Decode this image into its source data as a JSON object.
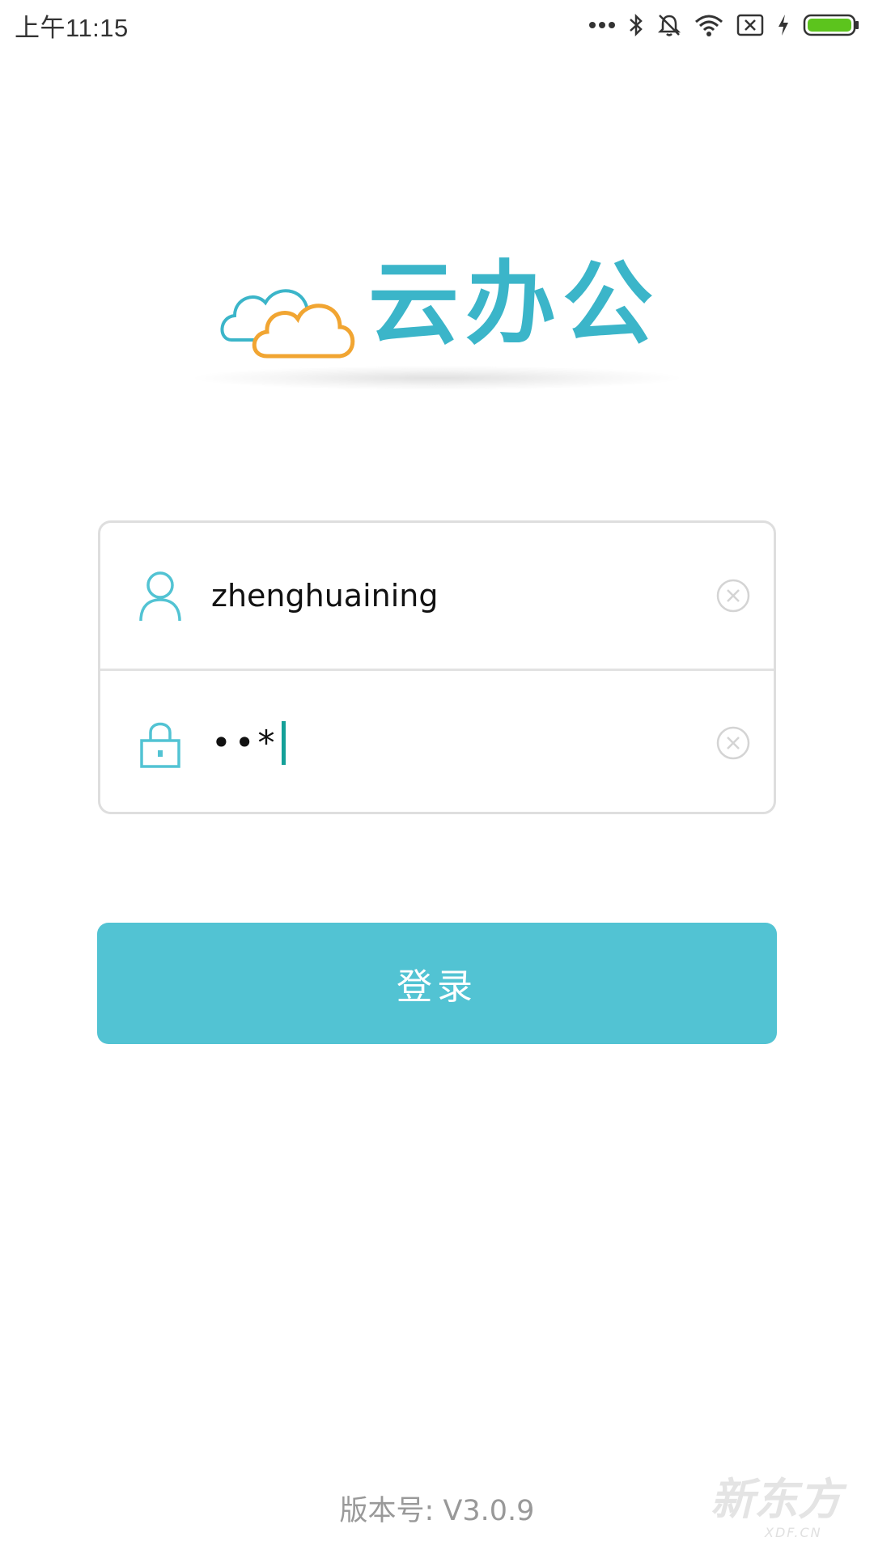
{
  "status_bar": {
    "time": "上午11:15",
    "icons": [
      "more-dots-icon",
      "bluetooth-icon",
      "mute-icon",
      "wifi-icon",
      "sim-off-icon",
      "charging-icon",
      "battery-icon"
    ]
  },
  "logo": {
    "text": "云办公",
    "icon": "cloud-icon"
  },
  "form": {
    "username": {
      "icon": "user-icon",
      "value": "zhenghuaining",
      "clear_icon": "clear-icon"
    },
    "password": {
      "icon": "lock-icon",
      "masked_value": "••*",
      "clear_icon": "clear-icon"
    }
  },
  "login_button": {
    "label": "登录"
  },
  "footer": {
    "version": "版本号: V3.0.9",
    "watermark": "新东方",
    "watermark_sub": "XDF.CN"
  },
  "colors": {
    "accent": "#52c3d3",
    "logo_text": "#3bb5c9",
    "cloud_orange": "#f1a532",
    "cursor": "#14a098"
  }
}
